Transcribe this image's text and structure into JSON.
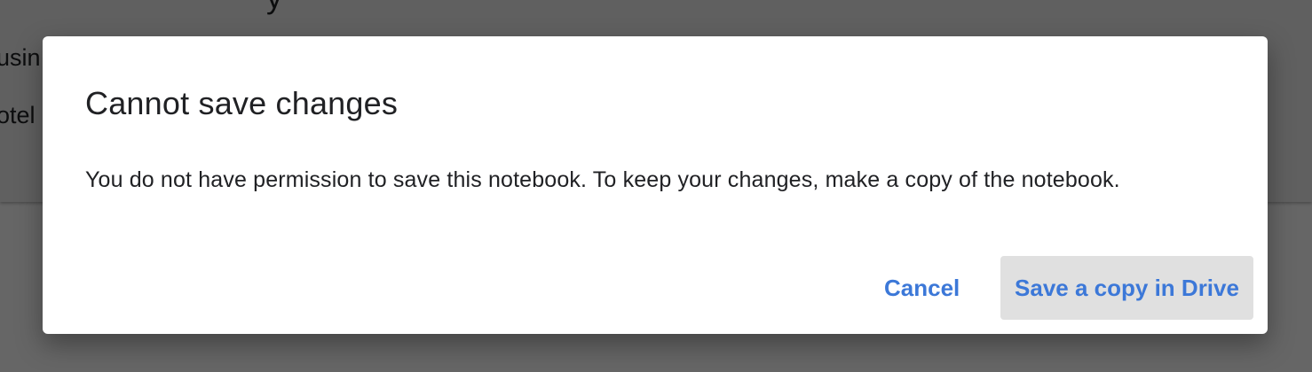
{
  "background": {
    "lines": [
      "usin",
      "otel"
    ]
  },
  "dialog": {
    "title": "Cannot save changes",
    "body": "You do not have permission to save this notebook. To keep your changes, make a copy of the notebook.",
    "buttons": {
      "cancel": "Cancel",
      "save_copy": "Save a copy in Drive"
    }
  },
  "colors": {
    "accent": "#3c78d8",
    "overlay": "rgba(0,0,0,0.6)",
    "primary_button_bg": "#e0e0e0",
    "text": "#202124"
  }
}
